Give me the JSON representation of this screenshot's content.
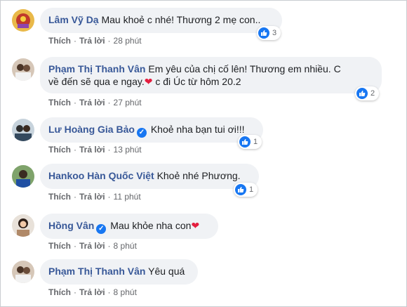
{
  "actions": {
    "like": "Thích",
    "reply": "Trả lời",
    "sep": "·"
  },
  "icons": {
    "like": "like-thumb-icon",
    "verified": "verified-check-icon",
    "heart": "red-heart-icon"
  },
  "colors": {
    "name": "#385898",
    "bubble": "#f0f2f5",
    "like": "#1877f2",
    "heart": "#e41e3f"
  },
  "comments": [
    {
      "name": "Lâm Vỹ Dạ",
      "text": "Mau khoẻ c nhé! Thương 2 mẹ con..",
      "time": "28 phút",
      "likes": "3"
    },
    {
      "name": "Phạm Thị Thanh Vân",
      "text1": "Em yêu của chị cố lên! Thương em nhiều. C",
      "text2a": "về đến sẽ qua e ngay.",
      "text2b": " c đi Úc từ hôm 20.2",
      "time": "27 phút",
      "likes": "2"
    },
    {
      "name": "Lư Hoàng Gia Bảo",
      "text": "Khoẻ nha bạn tui ơi!!!",
      "time": "13 phút",
      "likes": "1"
    },
    {
      "name": "Hankoo Hàn Quốc Việt",
      "text": "Khoẻ nhé Phương.",
      "time": "11 phút",
      "likes": "1"
    },
    {
      "name": "Hồng Vân",
      "text": "Mau khỏe nha con",
      "time": "8 phút"
    },
    {
      "name": "Phạm Thị Thanh Vân",
      "text": "Yêu quá",
      "time": "8 phút"
    }
  ]
}
